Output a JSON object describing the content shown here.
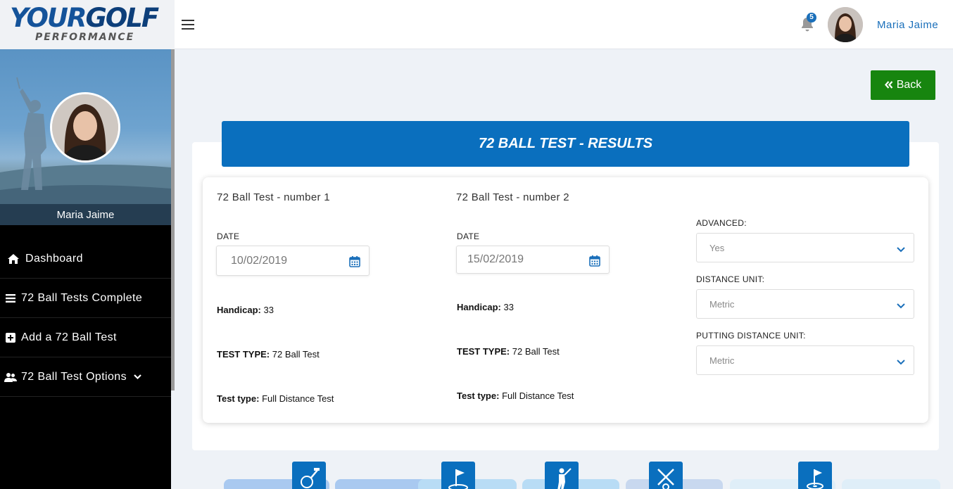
{
  "brand": {
    "logo_main_a": "YOUR",
    "logo_main_b": "GOLF",
    "logo_sub": "PERFORMANCE"
  },
  "header": {
    "notification_count": "5",
    "user_name": "Maria Jaime"
  },
  "sidebar": {
    "profile_name": "Maria Jaime",
    "items": [
      {
        "label": "Dashboard",
        "icon": "home-icon"
      },
      {
        "label": "72 Ball Tests Complete",
        "icon": "list-icon"
      },
      {
        "label": "Add a 72 Ball Test",
        "icon": "plus-square-icon"
      },
      {
        "label": "72 Ball Test Options",
        "icon": "users-icon"
      }
    ]
  },
  "main": {
    "back_label": "Back",
    "results_title": "72 BALL TEST - RESULTS",
    "tests": [
      {
        "title": "72 Ball Test - number 1",
        "date_label": "DATE",
        "date_value": "10/02/2019",
        "handicap_label": "Handicap:",
        "handicap_value": "33",
        "test_type_label": "TEST TYPE:",
        "test_type_value": "72 Ball Test",
        "test_subtype_label": "Test type:",
        "test_subtype_value": "Full Distance Test"
      },
      {
        "title": "72 Ball Test - number 2",
        "date_label": "DATE",
        "date_value": "15/02/2019",
        "handicap_label": "Handicap:",
        "handicap_value": "33",
        "test_type_label": "TEST TYPE:",
        "test_type_value": "72 Ball Test",
        "test_subtype_label": "Test type:",
        "test_subtype_value": "Full Distance Test"
      }
    ],
    "options": {
      "advanced_label": "ADVANCED:",
      "advanced_value": "Yes",
      "distance_unit_label": "DISTANCE UNIT:",
      "distance_unit_value": "Metric",
      "putting_distance_unit_label": "PUTTING DISTANCE UNIT:",
      "putting_distance_unit_value": "Metric"
    }
  },
  "colors": {
    "brand_blue": "#0a6fbe",
    "back_green": "#17850f",
    "link_blue": "#1a6fba"
  }
}
